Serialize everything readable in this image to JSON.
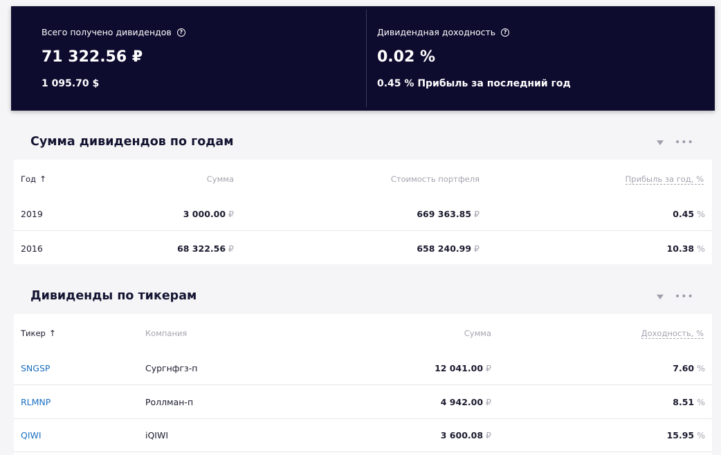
{
  "summary": {
    "total_label": "Всего получено дивидендов",
    "total_rub": "71 322.56 ₽",
    "total_usd": "1 095.70 $",
    "yield_label": "Дивидендная доходность",
    "yield_value": "0.02 %",
    "yield_sub": "0.45 % Прибыль за последний год",
    "help_glyph": "?"
  },
  "by_year": {
    "title": "Сумма дивидендов по годам",
    "headers": {
      "year": "Год",
      "sum": "Сумма",
      "portfolio": "Стоимость портфеля",
      "profit": "Прибыль за год, %"
    },
    "sort_arrow": "↑",
    "rows": [
      {
        "year": "2019",
        "sum": "3 000.00",
        "portfolio": "669 363.85",
        "profit": "0.45"
      },
      {
        "year": "2016",
        "sum": "68 322.56",
        "portfolio": "658 240.99",
        "profit": "10.38"
      }
    ]
  },
  "by_ticker": {
    "title": "Дивиденды по тикерам",
    "headers": {
      "ticker": "Тикер",
      "company": "Компания",
      "sum": "Сумма",
      "yield": "Доходность, %"
    },
    "sort_arrow": "↑",
    "rows": [
      {
        "ticker": "SNGSP",
        "company": "Сургнфгз-п",
        "sum": "12 041.00",
        "yield": "7.60"
      },
      {
        "ticker": "RLMNP",
        "company": "Роллман-п",
        "sum": "4 942.00",
        "yield": "8.51"
      },
      {
        "ticker": "QIWI",
        "company": "iQIWI",
        "sum": "3 600.08",
        "yield": "15.95"
      }
    ]
  },
  "units": {
    "rub": "₽",
    "pct": "%"
  },
  "tools": {
    "more": "•••"
  },
  "colors": {
    "summary_bg": "#0d0b2e",
    "link": "#1a6fc2",
    "muted": "#a4a4b0"
  }
}
